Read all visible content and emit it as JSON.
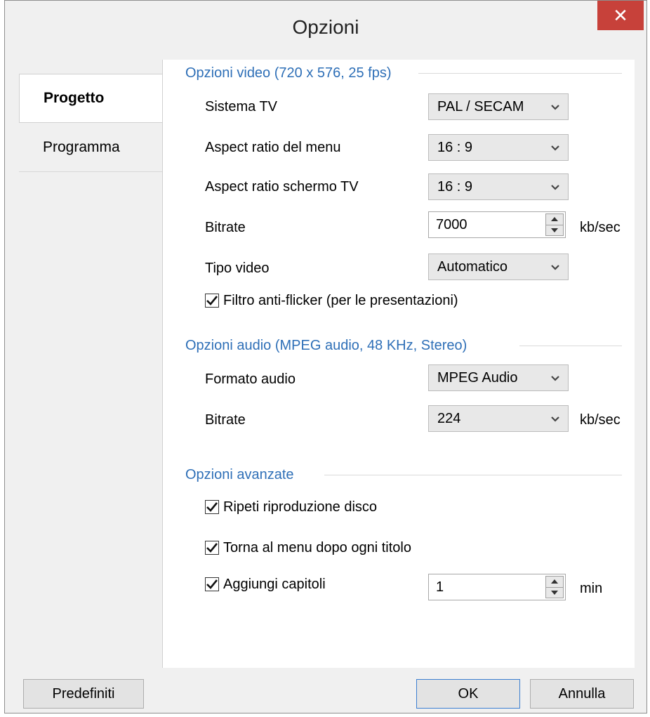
{
  "window": {
    "title": "Opzioni"
  },
  "tabs": [
    {
      "label": "Progetto",
      "active": true
    },
    {
      "label": "Programma",
      "active": false
    }
  ],
  "video": {
    "heading": "Opzioni video (720 x 576, 25 fps)",
    "tv_system": {
      "label": "Sistema TV",
      "value": "PAL / SECAM"
    },
    "menu_aspect": {
      "label": "Aspect ratio del menu",
      "value": "16 : 9"
    },
    "tv_aspect": {
      "label": "Aspect ratio schermo TV",
      "value": "16 : 9"
    },
    "bitrate": {
      "label": "Bitrate",
      "value": "7000",
      "unit": "kb/sec"
    },
    "video_type": {
      "label": "Tipo video",
      "value": "Automatico"
    },
    "antiflicker": {
      "label": "Filtro anti-flicker (per le presentazioni)",
      "checked": true
    }
  },
  "audio": {
    "heading": "Opzioni audio (MPEG audio, 48 KHz, Stereo)",
    "format": {
      "label": "Formato audio",
      "value": "MPEG Audio"
    },
    "bitrate": {
      "label": "Bitrate",
      "value": "224",
      "unit": "kb/sec"
    }
  },
  "advanced": {
    "heading": "Opzioni avanzate",
    "repeat": {
      "label": "Ripeti riproduzione disco",
      "checked": true
    },
    "return_menu": {
      "label": "Torna al menu dopo ogni titolo",
      "checked": true
    },
    "chapters": {
      "label": "Aggiungi capitoli",
      "checked": true,
      "value": "1",
      "unit": "min"
    }
  },
  "footer": {
    "defaults_label": "Predefiniti",
    "ok_label": "OK",
    "cancel_label": "Annulla"
  },
  "colors": {
    "accent": "#2e6fb7",
    "close": "#c7413a"
  }
}
